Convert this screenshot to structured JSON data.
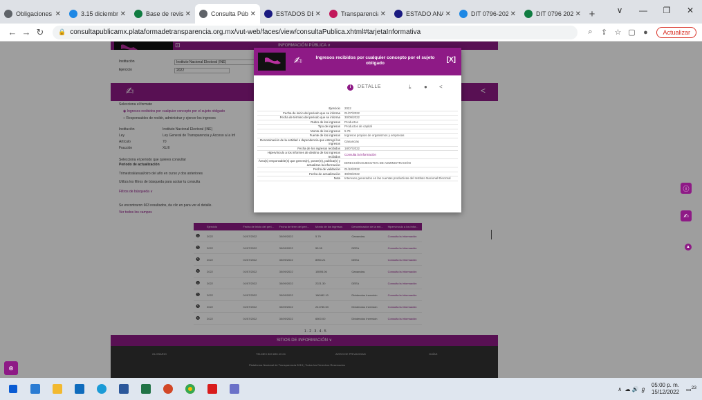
{
  "browser": {
    "tabs": [
      {
        "title": "Obligaciones",
        "color": "#5f6368"
      },
      {
        "title": "3.15 diciembr",
        "color": "#1e88e5"
      },
      {
        "title": "Base de revisi",
        "color": "#107c41"
      },
      {
        "title": "Consulta Públi",
        "color": "#5f6368",
        "active": true
      },
      {
        "title": "ESTADOS DE",
        "color": "#1a1a80"
      },
      {
        "title": "Transparencia",
        "color": "#c2185b"
      },
      {
        "title": "ESTADO ANA",
        "color": "#1a1a80"
      },
      {
        "title": "DIT 0796-202",
        "color": "#1e88e5"
      },
      {
        "title": "DIT 0796 202",
        "color": "#107c41"
      }
    ],
    "url": "consultapublicamx.plataformadetransparencia.org.mx/vut-web/faces/view/consultaPublica.xhtml#tarjetaInformativa",
    "update_label": "Actualizar"
  },
  "page": {
    "header_label": "INFORMACIÓN PÚBLICA ∨",
    "institucion_label": "Institución",
    "institucion_value": "Instituto Nacional Electoral (INE)",
    "ejercicio_label": "Ejercicio",
    "ejercicio_value": "2022",
    "seleccione_formato": "Selecciona el formato",
    "formato_1": "Ingresos recibidos por cualquier concepto por el sujeto obligado",
    "formato_2": "Responsables de recibir, administrar y ejercer los ingresos",
    "info_rows": [
      {
        "label": "Institución",
        "value": "Instituto Nacional Electoral (INE)"
      },
      {
        "label": "Ley",
        "value": "Ley General de Transparencia y Acceso a la Inf"
      },
      {
        "label": "Artículo",
        "value": "70"
      },
      {
        "label": "Fracción",
        "value": "XLIII"
      }
    ],
    "periodo_label": "Selecciona el periodo que quieres consultar",
    "periodo_actualizacion": "Periodo de actualización",
    "trimestre_note": "Trimestral/anual/otro del año en curso y dos anteriores",
    "filtros_note": "Utiliza los filtros de búsqueda para acotar tu consulta",
    "filtros_label": "Filtros de búsqueda ∨",
    "resultados": "Se encontraron 663 resultados, da clic en  para ver el detalle.",
    "ver_campos": "Ver todos los campos",
    "grid_headers": [
      "Ejercicio",
      "Fecha de inicio del peri...",
      "Fecha de térm del peri...",
      "Monto de los ingresos",
      "Denominación de la ent...",
      "Hipervínculo a los infor..."
    ],
    "grid_rows": [
      [
        "2022",
        "01/07/2022",
        "30/09/2022",
        "5.79",
        "Ganancias",
        "Consulta la información"
      ],
      [
        "2022",
        "01/07/2022",
        "30/09/2022",
        "55.95",
        "DEEA",
        "Consulta la información"
      ],
      [
        "2022",
        "01/07/2022",
        "30/09/2022",
        "8950.21",
        "DEEA",
        "Consulta la información"
      ],
      [
        "2022",
        "01/07/2022",
        "30/09/2022",
        "15595.06",
        "Ganancias",
        "Consulta la información"
      ],
      [
        "2022",
        "01/07/2022",
        "30/09/2022",
        "2221.30",
        "DEEA",
        "Consulta la información"
      ],
      [
        "2022",
        "01/07/2022",
        "30/09/2022",
        "180482.10",
        "Dividendos Inversión",
        "Consulta la información"
      ],
      [
        "2022",
        "01/07/2022",
        "30/09/2022",
        "241785.53",
        "Dividendos Inversión",
        "Consulta la información"
      ],
      [
        "2022",
        "01/07/2022",
        "30/09/2022",
        "6500.00",
        "Dividendos Inversión",
        "Consulta la información"
      ]
    ],
    "pager": "1 · 2 · 3 · 4 · 5",
    "sitios": "SITIOS DE INFORMACIÓN ∨",
    "footer_links": [
      "GLOSARIO",
      "TELMEX 800 835 43 24",
      "AVISO DE PRIVACIDAD",
      "GUÍAS"
    ],
    "footer_copy": "Plataforma Nacional de Transparencia 2019 | Todos los Derechos Reservados"
  },
  "modal": {
    "title": "Ingresos recibidos por cualquier concepto por el sujeto obligado",
    "close_label": "[X]",
    "detalle_label": "DETALLE",
    "fields": [
      {
        "label": "Ejercicio",
        "value": "2022"
      },
      {
        "label": "Fecha de inicio del periodo que se informa",
        "value": "01/07/2022"
      },
      {
        "label": "Fecha de término del periodo que se informa",
        "value": "30/09/2022"
      },
      {
        "label": "Rubro de los ingresos",
        "value": "Productos"
      },
      {
        "label": "Tipo de ingresos",
        "value": "Productos de capital"
      },
      {
        "label": "Monto de los ingresos",
        "value": "5.79"
      },
      {
        "label": "Fuente de los ingresos",
        "value": "Ingresos propios de organismos y empresas"
      },
      {
        "label": "Denominación de la entidad o dependencia que entregó los ingresos",
        "value": "Ganancias"
      },
      {
        "label": "Fecha de los ingresos recibidos",
        "value": "18/07/2022"
      },
      {
        "label": "Hipervínculo a los informes de destino de los ingresos recibidos",
        "value": "Consulta la información",
        "link": true
      },
      {
        "label": "Área(s) responsable(s) que genera(n), posee(n), publica(n) y actualizan la información",
        "value": "DIRECCIÓN EJECUTIVA DE ADMINISTRACIÓN"
      },
      {
        "label": "Fecha de validación",
        "value": "01/10/2022"
      },
      {
        "label": "Fecha de actualización",
        "value": "30/09/2022"
      },
      {
        "label": "Nota",
        "value": "Intereses generados en las cuentas productivas del Instituto Nacional Electoral"
      }
    ]
  },
  "taskbar": {
    "clock_time": "05:00 p. m.",
    "clock_date": "15/12/2022",
    "notif": "23"
  },
  "colors": {
    "primary": "#8e1a86",
    "dark": "#333333"
  }
}
